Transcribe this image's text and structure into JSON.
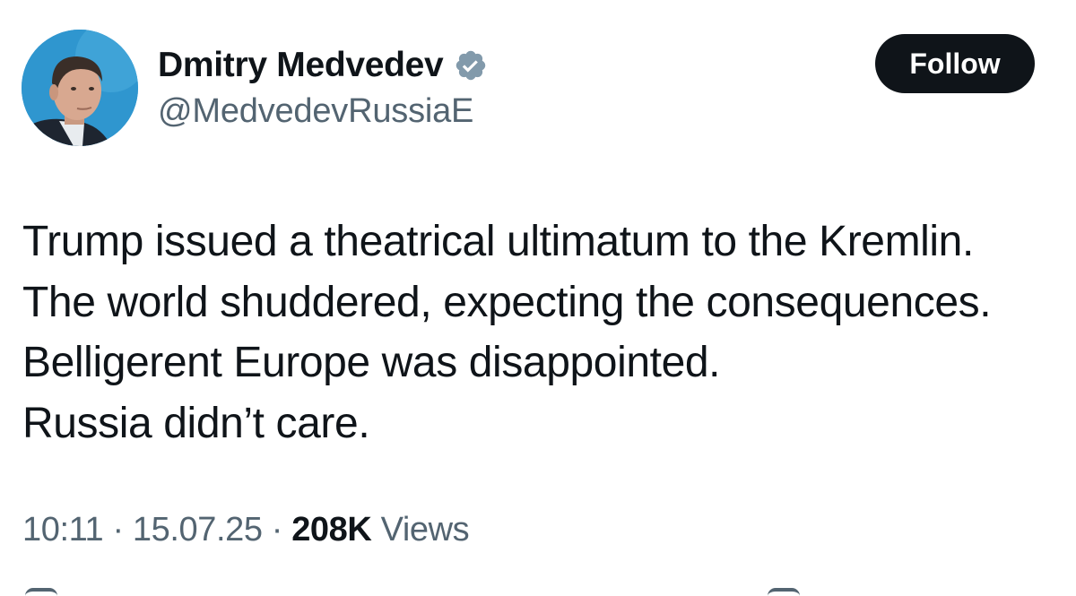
{
  "author": {
    "display_name": "Dmitry Medvedev",
    "handle": "@MedvedevRussiaE",
    "verified_icon": "verified-badge-icon",
    "verified_color": "#829aab"
  },
  "follow_button": {
    "label": "Follow"
  },
  "tweet": {
    "lines": [
      "Trump issued a theatrical ultimatum to the Kremlin.",
      "The world shuddered, expecting the consequences.",
      "Belligerent Europe was disappointed.",
      "Russia didn’t care."
    ]
  },
  "meta": {
    "time": "10:11",
    "separator": "·",
    "date": "15.07.25",
    "views_count": "208K",
    "views_label": "Views"
  },
  "colors": {
    "text": "#0f1419",
    "secondary": "#536471",
    "button_bg": "#0f1419",
    "button_text": "#ffffff",
    "avatar_bg": "#2f96cf"
  }
}
